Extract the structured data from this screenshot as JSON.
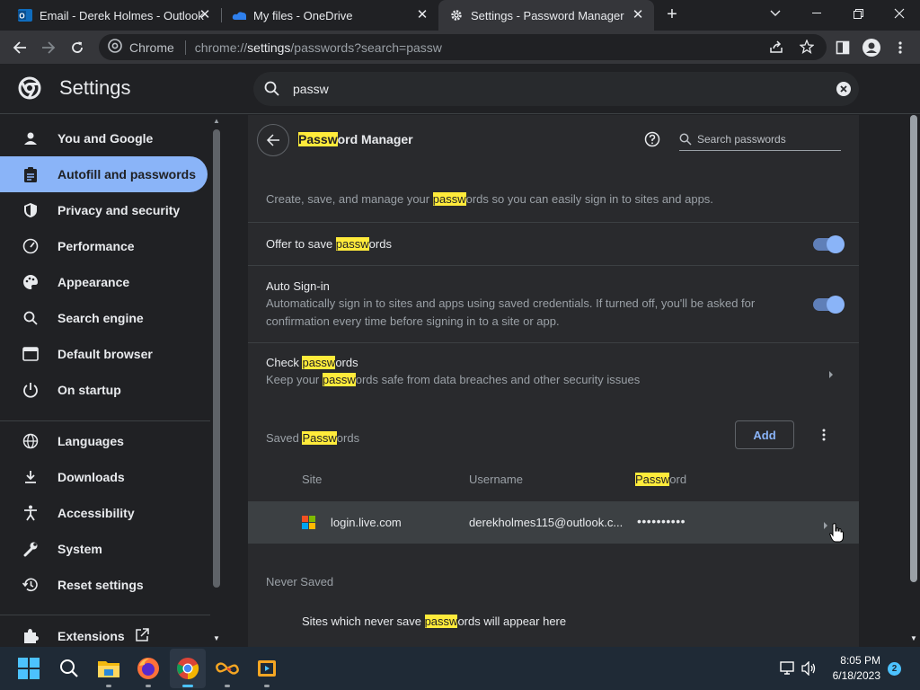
{
  "tabs": [
    {
      "label": "Email - Derek Holmes - Outlook",
      "icon": "outlook-icon"
    },
    {
      "label": "My files - OneDrive",
      "icon": "onedrive-icon"
    },
    {
      "label": "Settings - Password Manager",
      "icon": "gear-icon"
    }
  ],
  "toolbar": {
    "chip_label": "Chrome",
    "url_prefix": "chrome://",
    "url_host": "settings",
    "url_rest": "/passwords?search=passw"
  },
  "header": {
    "title": "Settings",
    "search_value": "passw"
  },
  "sidebar": {
    "items": [
      {
        "label": "You and Google",
        "icon": "person-icon"
      },
      {
        "label": "Autofill and passwords",
        "icon": "clipboard-icon"
      },
      {
        "label": "Privacy and security",
        "icon": "shield-icon"
      },
      {
        "label": "Performance",
        "icon": "speedometer-icon"
      },
      {
        "label": "Appearance",
        "icon": "palette-icon"
      },
      {
        "label": "Search engine",
        "icon": "search-icon"
      },
      {
        "label": "Default browser",
        "icon": "browser-icon"
      },
      {
        "label": "On startup",
        "icon": "power-icon"
      },
      {
        "label": "Languages",
        "icon": "globe-icon"
      },
      {
        "label": "Downloads",
        "icon": "download-icon"
      },
      {
        "label": "Accessibility",
        "icon": "accessibility-icon"
      },
      {
        "label": "System",
        "icon": "wrench-icon"
      },
      {
        "label": "Reset settings",
        "icon": "history-icon"
      },
      {
        "label": "Extensions",
        "icon": "puzzle-icon"
      }
    ]
  },
  "pm": {
    "title_hl": "Passw",
    "title_rest": "ord Manager",
    "search_placeholder": "Search passwords",
    "intro_pre": "Create, save, and manage your ",
    "intro_hl": "passw",
    "intro_post": "ords so you can easily sign in to sites and apps.",
    "offer_pre": "Offer to save ",
    "offer_hl": "passw",
    "offer_post": "ords",
    "autosignin_title": "Auto Sign-in",
    "autosignin_desc": "Automatically sign in to sites and apps using saved credentials. If turned off, you'll be asked for confirmation every time before signing in to a site or app.",
    "check_pre": "Check ",
    "check_hl": "passw",
    "check_post": "ords",
    "check_desc_pre": "Keep your ",
    "check_desc_hl": "passw",
    "check_desc_post": "ords safe from data breaches and other security issues",
    "saved_pre": "Saved ",
    "saved_hl": "Passw",
    "saved_post": "ords",
    "add_label": "Add",
    "col_site": "Site",
    "col_username": "Username",
    "col_password_hl": "Passw",
    "col_password_rest": "ord",
    "row_site": "login.live.com",
    "row_username": "derekholmes115@outlook.c...",
    "row_password": "••••••••••",
    "never_saved": "Never Saved",
    "never_pre": "Sites which never save ",
    "never_hl": "passw",
    "never_post": "ords will appear here"
  },
  "taskbar": {
    "time": "8:05 PM",
    "date": "6/18/2023",
    "badge": "2"
  }
}
